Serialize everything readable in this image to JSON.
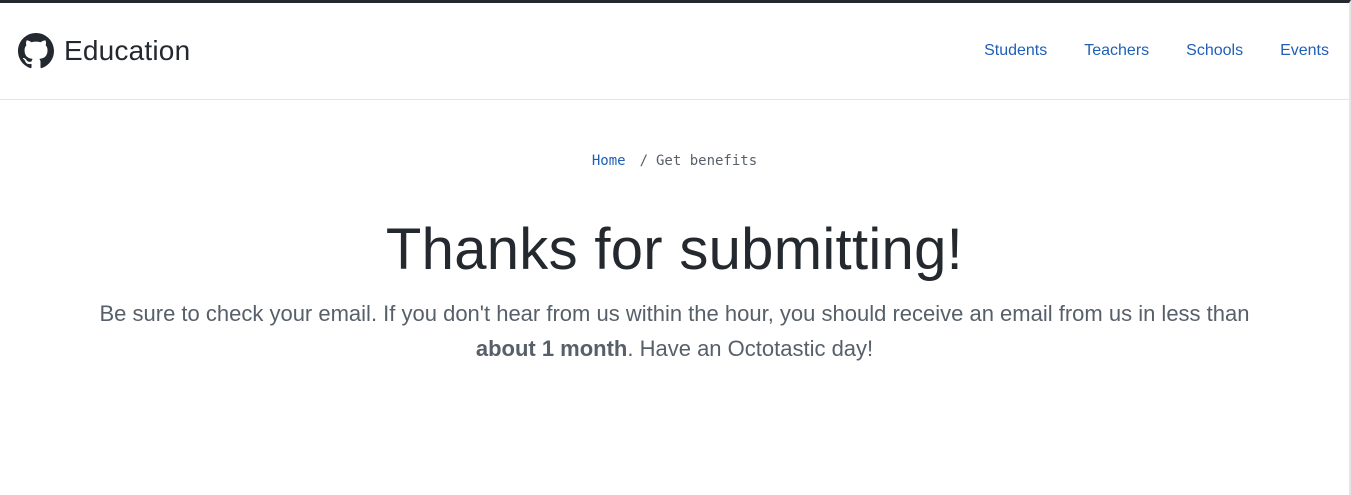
{
  "header": {
    "brand_name": "Education",
    "logo_icon": "github-octocat-icon",
    "nav": [
      {
        "label": "Students"
      },
      {
        "label": "Teachers"
      },
      {
        "label": "Schools"
      },
      {
        "label": "Events"
      }
    ]
  },
  "breadcrumb": {
    "home": "Home",
    "separator": "/",
    "current": "Get benefits"
  },
  "main": {
    "title": "Thanks for submitting!",
    "message_before": "Be sure to check your email. If you don't hear from us within the hour, you should receive an email from us in less than ",
    "message_bold": "about 1 month",
    "message_after": ". Have an Octotastic day!"
  },
  "colors": {
    "link": "#1f5fb8",
    "text": "#24292f",
    "muted": "#57606a",
    "top_border": "#24292f"
  }
}
